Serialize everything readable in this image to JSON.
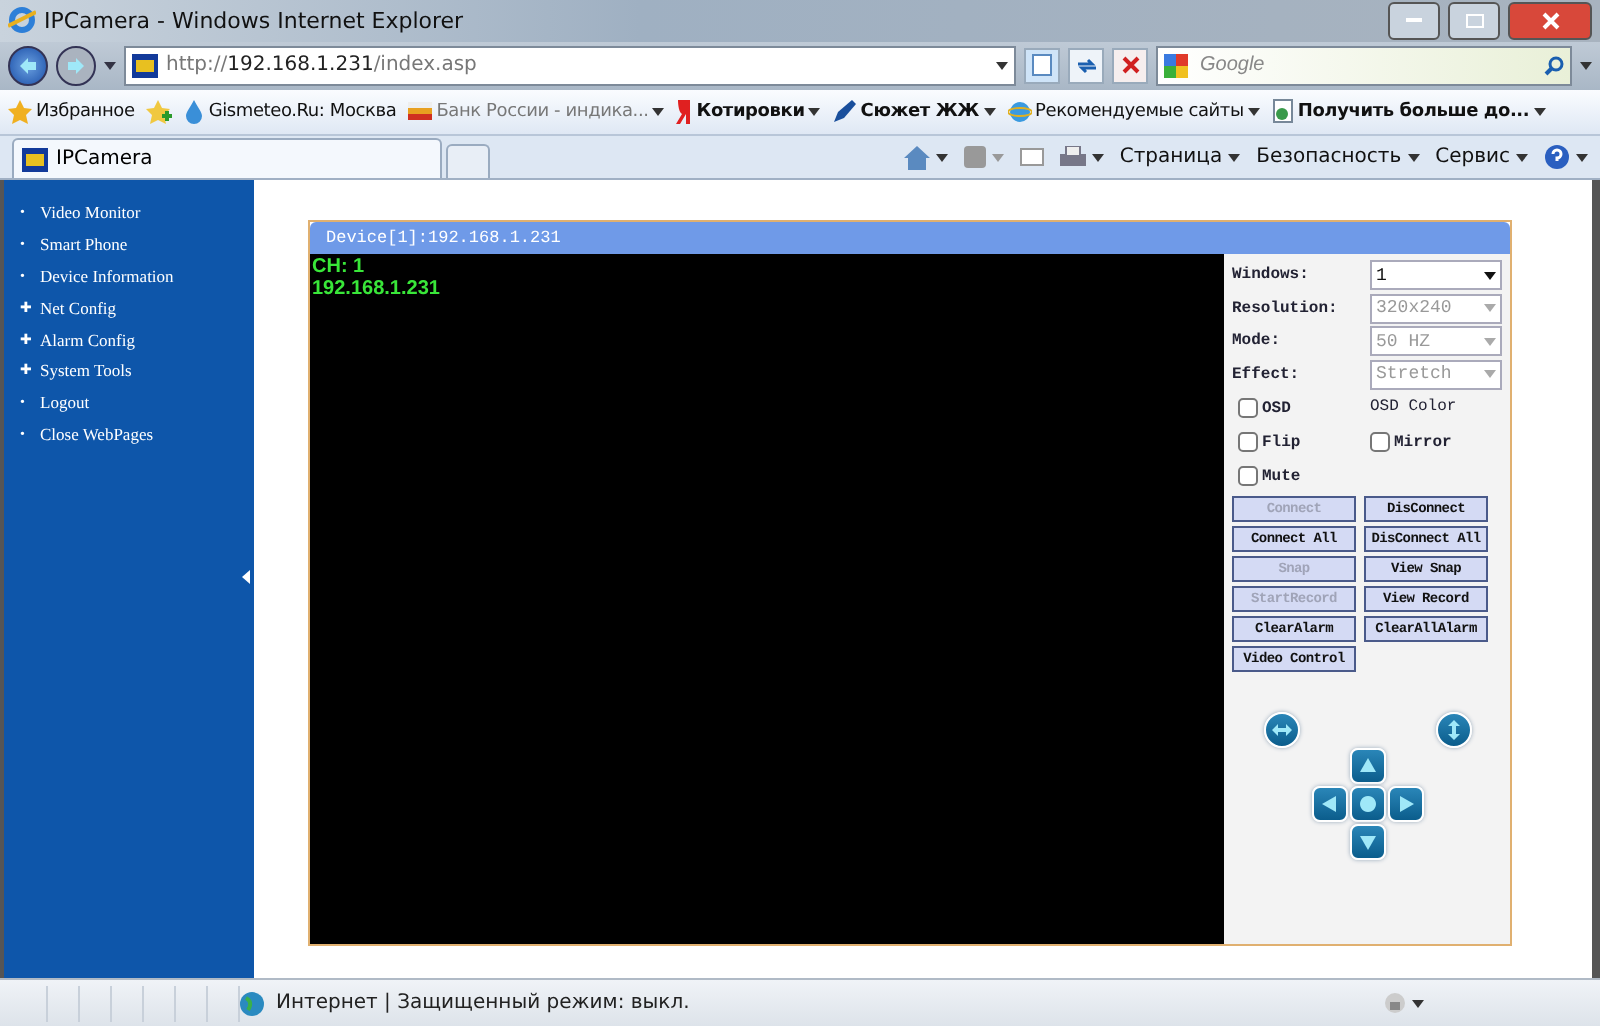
{
  "window": {
    "title": "IPCamera - Windows Internet Explorer"
  },
  "address_bar": {
    "url_scheme": "http://",
    "url_host": "192.168.1.231",
    "url_path": "/index.asp",
    "search_placeholder": "Google"
  },
  "favorites_bar": {
    "label": "Избранное",
    "items": [
      {
        "label": "Gismeteo.Ru: Москва",
        "kind": "drop",
        "bold": false,
        "dropdown": false,
        "dim": false
      },
      {
        "label": "Банк России - индика...",
        "kind": "flag",
        "bold": false,
        "dropdown": true,
        "dim": true
      },
      {
        "label": "Котировки",
        "kind": "ya",
        "bold": true,
        "dropdown": true,
        "dim": false
      },
      {
        "label": "Сюжет ЖЖ",
        "kind": "pen",
        "bold": true,
        "dropdown": true,
        "dim": false
      },
      {
        "label": "Рекомендуемые сайты",
        "kind": "ie",
        "bold": false,
        "dropdown": true,
        "dim": false
      },
      {
        "label": "Получить больше до...",
        "kind": "page",
        "bold": true,
        "dropdown": true,
        "dim": false
      }
    ]
  },
  "tabs": [
    {
      "label": "IPCamera",
      "selected": true
    }
  ],
  "command_bar": [
    "Страница",
    "Безопасность",
    "Сервис"
  ],
  "sidebar": {
    "items": [
      {
        "marker": "•",
        "label": "Video Monitor"
      },
      {
        "marker": "•",
        "label": "Smart Phone"
      },
      {
        "marker": "•",
        "label": "Device Information"
      },
      {
        "marker": "✚",
        "label": "Net Config"
      },
      {
        "marker": "✚",
        "label": "Alarm Config"
      },
      {
        "marker": "✚",
        "label": "System Tools"
      },
      {
        "marker": "•",
        "label": "Logout"
      },
      {
        "marker": "•",
        "label": "Close WebPages"
      }
    ]
  },
  "device": {
    "title": "Device[1]:192.168.1.231",
    "channel": "CH: 1",
    "ip": "192.168.1.231"
  },
  "settings": [
    {
      "label": "Windows:",
      "value": "1",
      "disabled": false
    },
    {
      "label": "Resolution:",
      "value": "320x240",
      "disabled": true
    },
    {
      "label": "Mode:",
      "value": "50 HZ",
      "disabled": true
    },
    {
      "label": "Effect:",
      "value": "Stretch",
      "disabled": true
    }
  ],
  "osd_color_label": "OSD Color",
  "checkboxes": [
    {
      "label": "OSD",
      "checked": false
    },
    {
      "label": "Flip",
      "checked": false
    },
    {
      "label": "Mirror",
      "checked": false
    },
    {
      "label": "Mute",
      "checked": false
    }
  ],
  "buttons": [
    {
      "label": "Connect",
      "disabled": true
    },
    {
      "label": "DisConnect",
      "disabled": false
    },
    {
      "label": "Connect All",
      "disabled": false
    },
    {
      "label": "DisConnect All",
      "disabled": false
    },
    {
      "label": "Snap",
      "disabled": true
    },
    {
      "label": "View Snap",
      "disabled": false
    },
    {
      "label": "StartRecord",
      "disabled": true
    },
    {
      "label": "View Record",
      "disabled": false
    },
    {
      "label": "ClearAlarm",
      "disabled": false
    },
    {
      "label": "ClearAllAlarm",
      "disabled": false
    },
    {
      "label": "Video Control",
      "disabled": false
    }
  ],
  "status_bar": {
    "zone": "Интернет | Защищенный режим: выкл."
  }
}
